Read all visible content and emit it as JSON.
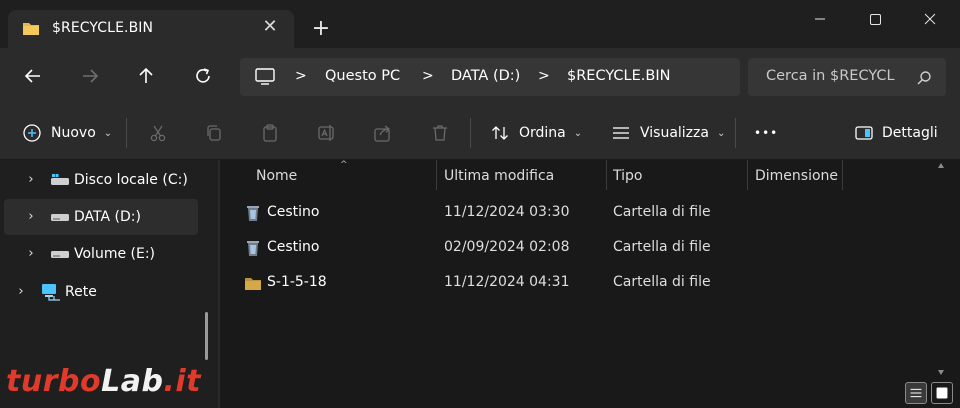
{
  "tab": {
    "title": "$RECYCLE.BIN",
    "close_glyph": "✕",
    "new_glyph": "+"
  },
  "window_controls": [
    "minimize-icon",
    "maximize-icon",
    "close-icon"
  ],
  "nav_buttons": [
    "back-arrow-icon",
    "forward-arrow-icon",
    "up-arrow-icon",
    "refresh-icon"
  ],
  "address": {
    "root_icon": "computer-icon",
    "separator": ">",
    "crumbs": [
      "Questo PC",
      "DATA (D:)",
      "$RECYCLE.BIN"
    ]
  },
  "search": {
    "placeholder": "Cerca in $RECYCL"
  },
  "commands": {
    "new_label": "Nuovo",
    "sort_label": "Ordina",
    "view_label": "Visualizza",
    "more_glyph": "•••",
    "details_label": "Dettagli",
    "chevron": "⌄",
    "icons": [
      "cut-icon",
      "copy-icon",
      "paste-icon",
      "rename-icon",
      "share-icon",
      "delete-icon"
    ]
  },
  "nav_pane": {
    "chevron": "›",
    "items": [
      {
        "label": "Disco locale (C:)",
        "icon": "system-drive-icon",
        "selected": false
      },
      {
        "label": "DATA (D:)",
        "icon": "drive-icon",
        "selected": true
      },
      {
        "label": "Volume (E:)",
        "icon": "drive-icon",
        "selected": false
      },
      {
        "label": "Rete",
        "icon": "network-icon",
        "selected": false
      }
    ]
  },
  "columns": [
    "Nome",
    "Ultima modifica",
    "Tipo",
    "Dimensione"
  ],
  "sort_glyph": "^",
  "files": [
    {
      "name": "Cestino",
      "modified": "11/12/2024 03:30",
      "type": "Cartella di file",
      "icon": "recycle-bin-icon"
    },
    {
      "name": "Cestino",
      "modified": "02/09/2024 02:08",
      "type": "Cartella di file",
      "icon": "recycle-bin-icon"
    },
    {
      "name": "S-1-5-18",
      "modified": "11/12/2024 04:31",
      "type": "Cartella di file",
      "icon": "folder-icon"
    }
  ],
  "status_bar": {
    "view_buttons": [
      "details-view-icon",
      "large-icons-view-icon"
    ]
  },
  "watermark": {
    "part1": "turbo",
    "part2": "Lab",
    "part3": ".it"
  },
  "colors": {
    "accent": "#4cc2ff",
    "folder": "#e8b94a",
    "watermark_red": "#e23a2a"
  }
}
